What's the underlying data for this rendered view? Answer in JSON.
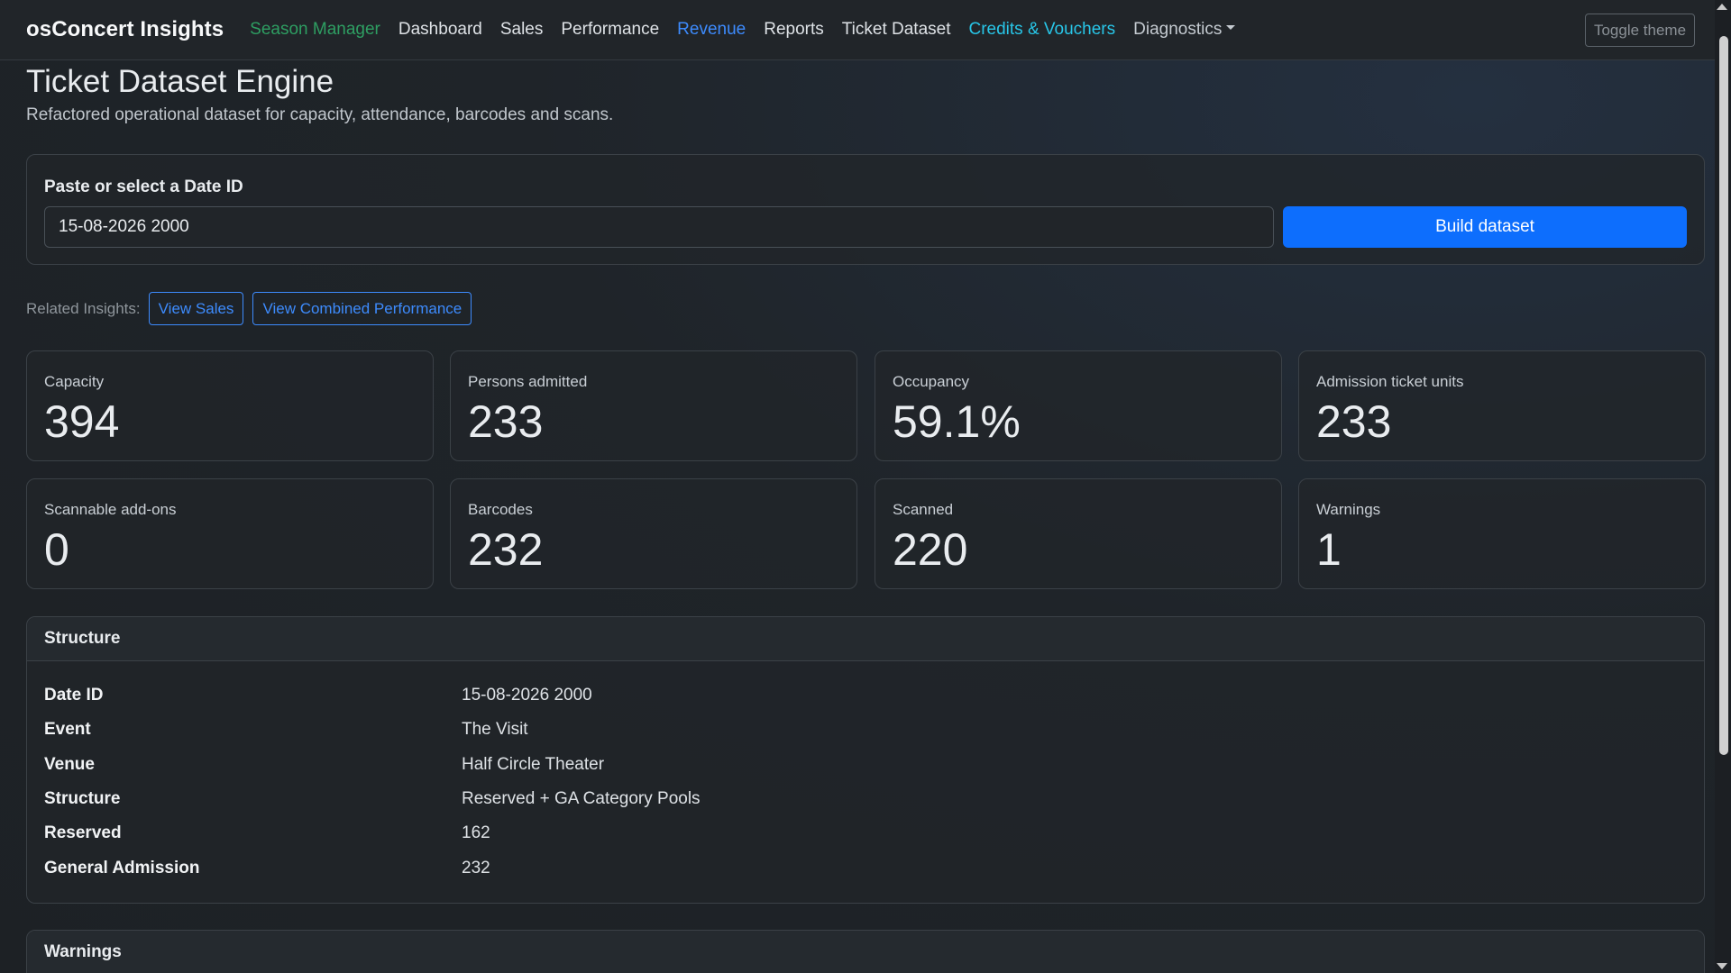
{
  "navbar": {
    "brand": "osConcert Insights",
    "links": [
      {
        "label": "Season Manager",
        "style": "green"
      },
      {
        "label": "Dashboard",
        "style": "default"
      },
      {
        "label": "Sales",
        "style": "default"
      },
      {
        "label": "Performance",
        "style": "default"
      },
      {
        "label": "Revenue",
        "style": "blue"
      },
      {
        "label": "Reports",
        "style": "default"
      },
      {
        "label": "Ticket Dataset",
        "style": "default"
      },
      {
        "label": "Credits & Vouchers",
        "style": "cyan"
      },
      {
        "label": "Diagnostics",
        "style": "muted"
      }
    ],
    "toggle_theme": "Toggle theme"
  },
  "page": {
    "title": "Ticket Dataset Engine",
    "subtitle": "Refactored operational dataset for capacity, attendance, barcodes and scans."
  },
  "date_form": {
    "label": "Paste or select a Date ID",
    "value": "15-08-2026 2000",
    "button": "Build dataset"
  },
  "related": {
    "label": "Related Insights:",
    "buttons": [
      "View Sales",
      "View Combined Performance"
    ]
  },
  "metrics": [
    {
      "label": "Capacity",
      "value": "394"
    },
    {
      "label": "Persons admitted",
      "value": "233"
    },
    {
      "label": "Occupancy",
      "value": "59.1%"
    },
    {
      "label": "Admission ticket units",
      "value": "233"
    },
    {
      "label": "Scannable add-ons",
      "value": "0"
    },
    {
      "label": "Barcodes",
      "value": "232"
    },
    {
      "label": "Scanned",
      "value": "220"
    },
    {
      "label": "Warnings",
      "value": "1"
    }
  ],
  "structure": {
    "header": "Structure",
    "rows": [
      {
        "key": "Date ID",
        "value": "15-08-2026 2000"
      },
      {
        "key": "Event",
        "value": "The Visit"
      },
      {
        "key": "Venue",
        "value": "Half Circle Theater"
      },
      {
        "key": "Structure",
        "value": "Reserved + GA Category Pools"
      },
      {
        "key": "Reserved",
        "value": "162"
      },
      {
        "key": "General Admission",
        "value": "232"
      }
    ]
  },
  "warnings": {
    "header": "Warnings"
  },
  "colors": {
    "primary": "#0d6efd",
    "link_blue": "#3d8bfd",
    "link_green": "#2e9e62",
    "link_cyan": "#28c6e8",
    "background": "#1f2327"
  }
}
